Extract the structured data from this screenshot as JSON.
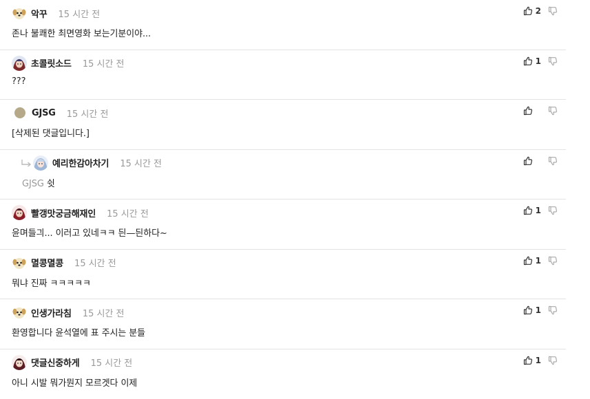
{
  "comments": [
    {
      "nickname": "악꾸",
      "time": "15 시간 전",
      "text": "존나 불쾌한 최면영화 보는기분이야...",
      "upvotes": "2",
      "avatar_icon": "dog-avatar-icon"
    },
    {
      "nickname": "초콜릿소드",
      "time": "15 시간 전",
      "text": "???",
      "upvotes": "1",
      "avatar_icon": "character-avatar-icon"
    },
    {
      "nickname": "GJSG",
      "time": "15 시간 전",
      "text": "[삭제된 댓글입니다.]",
      "upvotes": "",
      "avatar_icon": "default-avatar-icon"
    },
    {
      "nickname": "예리한감아차기",
      "time": "15 시간 전",
      "mention": "GJSG",
      "text": "쉿",
      "upvotes": "",
      "avatar_icon": "character-avatar-icon",
      "is_reply": true
    },
    {
      "nickname": "빨갱맛궁금해재인",
      "time": "15 시간 전",
      "text": "윤며들긔... 이러고 있네ㅋㅋ 듼—듼하다~",
      "upvotes": "1",
      "avatar_icon": "character-avatar-icon"
    },
    {
      "nickname": "멸콩멸콩",
      "time": "15 시간 전",
      "text": "뭐냐 진짜 ㅋㅋㅋㅋㅋ",
      "upvotes": "1",
      "avatar_icon": "dog-avatar-icon"
    },
    {
      "nickname": "인생가라침",
      "time": "15 시간 전",
      "text": "환영합니다 윤석열에 표 주시는 분들",
      "upvotes": "1",
      "avatar_icon": "dog-avatar-icon"
    },
    {
      "nickname": "댓글신중하게",
      "time": "15 시간 전",
      "text": "아니 시발 뭐가뭔지 모르겟다 이제",
      "upvotes": "1",
      "avatar_icon": "character-avatar-icon"
    }
  ],
  "icons": {
    "upvote": "thumbs-up-icon",
    "downvote": "thumbs-down-icon",
    "reply": "reply-arrow-icon"
  }
}
